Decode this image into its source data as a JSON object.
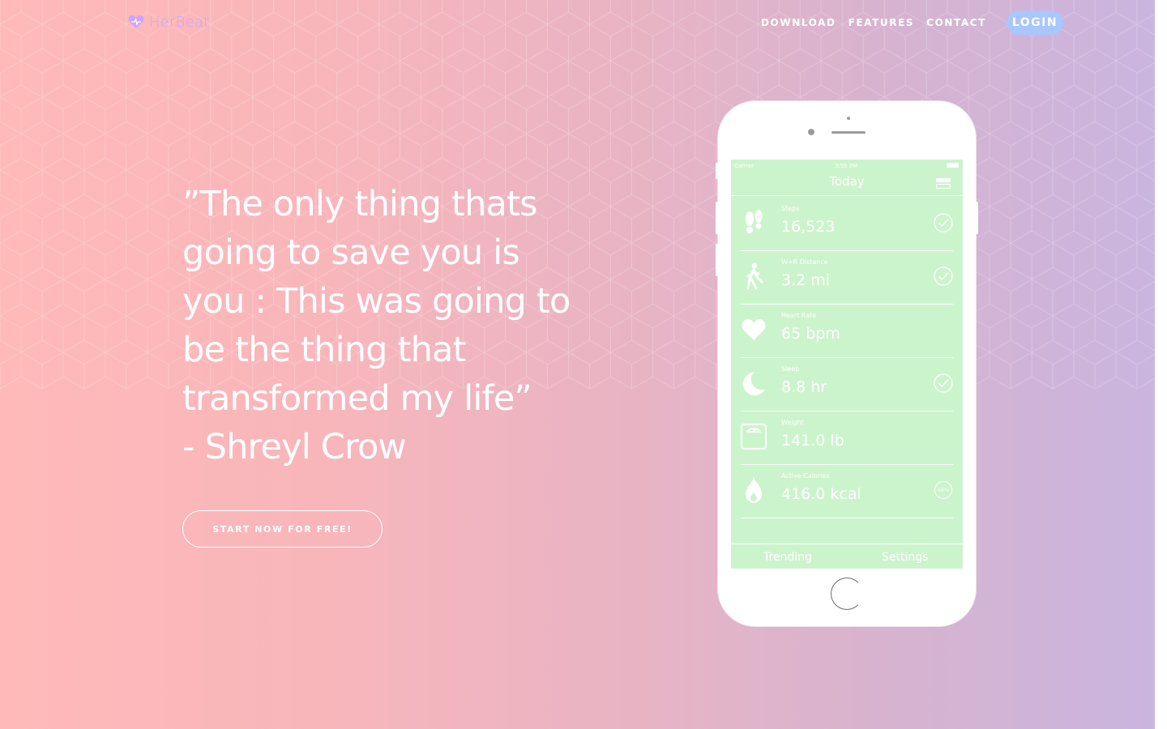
{
  "brand": {
    "name": "HerBeat",
    "logo_icon": "heart-icon",
    "accent_color": "#c9a6ff"
  },
  "nav": {
    "items": [
      "DOWNLOAD",
      "FEATURES",
      "CONTACT"
    ],
    "login_label": "LOGIN",
    "login_color": "#a8c6ff"
  },
  "hero": {
    "quote_lines": [
      "”The only thing thats",
      "going to save you is",
      "you : This was going to",
      "be the thing that",
      "transformed my life”",
      "- Shreyl Crow"
    ],
    "cta_label": "START NOW FOR FREE!",
    "gradient": [
      "#ffb9b9",
      "#cab5df"
    ]
  },
  "app": {
    "status": {
      "carrier": "Carrier",
      "time": "3:55 PM"
    },
    "title": "Today",
    "metrics": [
      {
        "label": "Steps",
        "value": "16,523",
        "icon": "footprints-icon",
        "status": "check"
      },
      {
        "label": "W+R Distance",
        "value": "3.2 mi",
        "icon": "walking-person-icon",
        "status": "check"
      },
      {
        "label": "Heart Rate",
        "value": "65 bpm",
        "icon": "heart-icon",
        "status": ""
      },
      {
        "label": "Sleep",
        "value": "8.8 hr",
        "icon": "moon-icon",
        "status": "check"
      },
      {
        "label": "Weight",
        "value": "141.0 lb",
        "icon": "scale-icon",
        "status": ""
      },
      {
        "label": "Active Calories",
        "value": "416.0 kcal",
        "icon": "flame-icon",
        "status": "69%"
      }
    ],
    "tabs": [
      "Trending",
      "Settings"
    ],
    "screen_color": "#ccf4cc"
  }
}
